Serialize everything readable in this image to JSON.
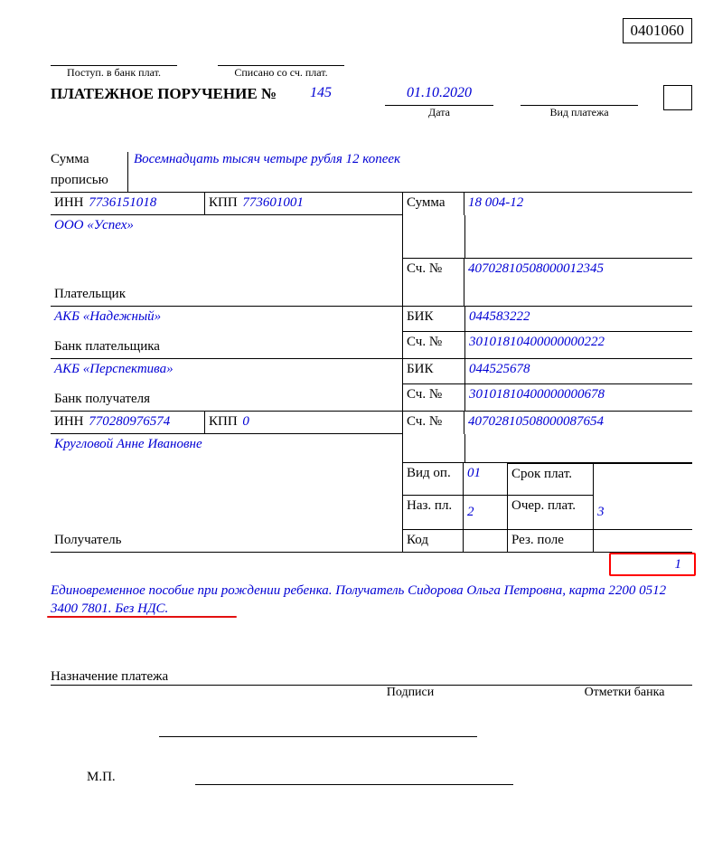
{
  "okud": "0401060",
  "top": {
    "postup_label": "Поступ. в банк плат.",
    "postup_value": "",
    "spisano_label": "Списано со сч. плат.",
    "spisano_value": ""
  },
  "title_prefix": "ПЛАТЕЖНОЕ ПОРУЧЕНИЕ №",
  "number": "145",
  "date": "01.10.2020",
  "date_label": "Дата",
  "vid_platezha_label": "Вид платежа",
  "vid_platezha": "",
  "sum_words_label1": "Сумма",
  "sum_words_label2": "прописью",
  "sum_words": "Восемнадцать тысяч четыре рубля 12 копеек",
  "table": {
    "inn_payer_label": "ИНН",
    "inn_payer": "7736151018",
    "kpp_payer_label": "КПП",
    "kpp_payer": "773601001",
    "sum_label": "Сумма",
    "sum": "18 004-12",
    "payer_name": "ООО «Успех»",
    "sch_label": "Сч. №",
    "payer_acc": "40702810508000012345",
    "payer_label": "Плательщик",
    "payer_bank": "АКБ «Надежный»",
    "bik_label": "БИК",
    "payer_bank_bik": "044583222",
    "payer_bank_acc": "30101810400000000222",
    "payer_bank_label": "Банк плательщика",
    "recv_bank": "АКБ «Перспектива»",
    "recv_bank_bik": "044525678",
    "recv_bank_acc": "30101810400000000678",
    "recv_bank_label": "Банк получателя",
    "inn_recv_label": "ИНН",
    "inn_recv": "770280976574",
    "kpp_recv_label": "КПП",
    "kpp_recv": "0",
    "recv_acc": "40702810508000087654",
    "recv_name": "Кругловой Анне Ивановне",
    "vid_op_label": "Вид оп.",
    "vid_op": "01",
    "srok_plat_label": "Срок плат.",
    "srok_plat": "",
    "naz_pl_label": "Наз. пл.",
    "naz_pl": "2",
    "ocher_plat_label": "Очер. плат.",
    "ocher_plat": "3",
    "kod_label": "Код",
    "kod": "",
    "rez_pole_label": "Рез. поле",
    "rez_pole": "",
    "recv_label": "Получатель"
  },
  "highlight_number": "1",
  "purpose": "Единовременное пособие при рождении ребенка. Получатель Сидорова Ольга Петровна, карта 2200 0512 3400 7801. Без НДС.",
  "purpose_label": "Назначение платежа",
  "signatures_label": "Подписи",
  "bank_marks_label": "Отметки банка",
  "mp_label": "М.П."
}
